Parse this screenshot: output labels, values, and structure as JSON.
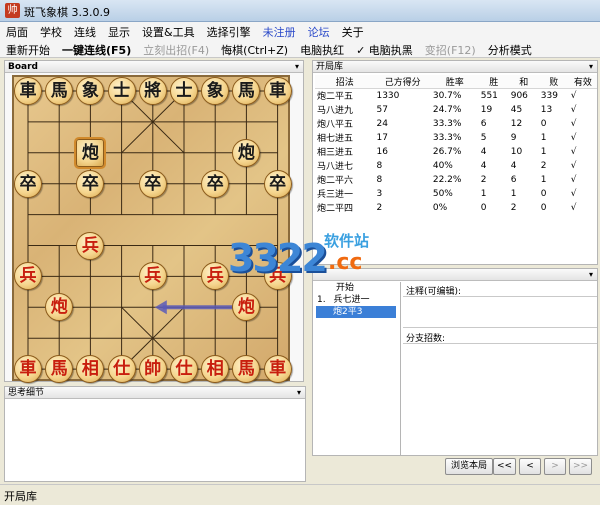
{
  "window": {
    "title": "斑飞象棋 3.3.0.9",
    "icon": "chess-app-icon"
  },
  "menubar": {
    "items": [
      "局面",
      "学校",
      "连线",
      "显示",
      "设置&工具",
      "选择引擎",
      "未注册",
      "论坛",
      "关于"
    ]
  },
  "toolbar": {
    "items": [
      "重新开始",
      "一键连线(F5)",
      "立刻出招(F4)",
      "悔棋(Ctrl+Z)",
      "电脑执红",
      "✓ 电脑执黑",
      "变招(F12)",
      "分析模式"
    ]
  },
  "board_panel": {
    "title": "Board"
  },
  "board": {
    "pieces": [
      {
        "char": "車",
        "side": "black",
        "col": 0,
        "row": 0
      },
      {
        "char": "馬",
        "side": "black",
        "col": 1,
        "row": 0
      },
      {
        "char": "象",
        "side": "black",
        "col": 2,
        "row": 0
      },
      {
        "char": "士",
        "side": "black",
        "col": 3,
        "row": 0
      },
      {
        "char": "將",
        "side": "black",
        "col": 4,
        "row": 0
      },
      {
        "char": "士",
        "side": "black",
        "col": 5,
        "row": 0
      },
      {
        "char": "象",
        "side": "black",
        "col": 6,
        "row": 0
      },
      {
        "char": "馬",
        "side": "black",
        "col": 7,
        "row": 0
      },
      {
        "char": "車",
        "side": "black",
        "col": 8,
        "row": 0
      },
      {
        "char": "炮",
        "side": "black",
        "col": 2,
        "row": 2,
        "selected": true
      },
      {
        "char": "炮",
        "side": "black",
        "col": 7,
        "row": 2
      },
      {
        "char": "卒",
        "side": "black",
        "col": 0,
        "row": 3
      },
      {
        "char": "卒",
        "side": "black",
        "col": 2,
        "row": 3
      },
      {
        "char": "卒",
        "side": "black",
        "col": 4,
        "row": 3
      },
      {
        "char": "卒",
        "side": "black",
        "col": 6,
        "row": 3
      },
      {
        "char": "卒",
        "side": "black",
        "col": 8,
        "row": 3
      },
      {
        "char": "兵",
        "side": "red",
        "col": 2,
        "row": 5
      },
      {
        "char": "兵",
        "side": "red",
        "col": 0,
        "row": 6
      },
      {
        "char": "兵",
        "side": "red",
        "col": 4,
        "row": 6
      },
      {
        "char": "兵",
        "side": "red",
        "col": 6,
        "row": 6
      },
      {
        "char": "兵",
        "side": "red",
        "col": 8,
        "row": 6
      },
      {
        "char": "炮",
        "side": "red",
        "col": 1,
        "row": 7
      },
      {
        "char": "炮",
        "side": "red",
        "col": 7,
        "row": 7
      },
      {
        "char": "車",
        "side": "red",
        "col": 0,
        "row": 9
      },
      {
        "char": "馬",
        "side": "red",
        "col": 1,
        "row": 9
      },
      {
        "char": "相",
        "side": "red",
        "col": 2,
        "row": 9
      },
      {
        "char": "仕",
        "side": "red",
        "col": 3,
        "row": 9
      },
      {
        "char": "帥",
        "side": "red",
        "col": 4,
        "row": 9
      },
      {
        "char": "仕",
        "side": "red",
        "col": 5,
        "row": 9
      },
      {
        "char": "相",
        "side": "red",
        "col": 6,
        "row": 9
      },
      {
        "char": "馬",
        "side": "red",
        "col": 7,
        "row": 9
      },
      {
        "char": "車",
        "side": "red",
        "col": 8,
        "row": 9
      }
    ],
    "last_move": {
      "from": [
        7,
        7
      ],
      "to": [
        4,
        7
      ],
      "color": "#5a5ab8"
    },
    "wood_color": "#dfba7d"
  },
  "think_panel": {
    "title": "思考细节"
  },
  "book_panel": {
    "title": "开局库",
    "columns": [
      "招法",
      "己方得分",
      "胜率",
      "胜",
      "和",
      "败",
      "有效"
    ],
    "rows": [
      [
        "炮二平五",
        "1330",
        "30.7%",
        "551",
        "906",
        "339",
        "√"
      ],
      [
        "马八进九",
        "57",
        "24.7%",
        "19",
        "45",
        "13",
        "√"
      ],
      [
        "炮八平五",
        "24",
        "33.3%",
        "6",
        "12",
        "0",
        "√"
      ],
      [
        "相七进五",
        "17",
        "33.3%",
        "5",
        "9",
        "1",
        "√"
      ],
      [
        "相三进五",
        "16",
        "26.7%",
        "4",
        "10",
        "1",
        "√"
      ],
      [
        "马八进七",
        "8",
        "40%",
        "4",
        "4",
        "2",
        "√"
      ],
      [
        "炮二平六",
        "8",
        "22.2%",
        "2",
        "6",
        "1",
        "√"
      ],
      [
        "兵三进一",
        "3",
        "50%",
        "1",
        "1",
        "0",
        "√"
      ],
      [
        "炮二平四",
        "2",
        "0%",
        "0",
        "2",
        "0",
        "√"
      ]
    ]
  },
  "moves_panel": {
    "moves": [
      {
        "text": "开始",
        "prefix": ""
      },
      {
        "text": "兵七进一",
        "prefix": "1."
      },
      {
        "text": "炮2平3",
        "prefix": ""
      }
    ],
    "active_index": 2,
    "comment_label": "注释(可编辑):",
    "branch_label": "分支招数:"
  },
  "nav": {
    "browse": "浏览本局",
    "first": "<<",
    "prev": "<",
    "next": ">",
    "last": ">>"
  },
  "status": {
    "text": "开局库"
  },
  "watermark": {
    "numbers": "3322",
    "chinese": "软件站",
    "domain": ".cc"
  }
}
